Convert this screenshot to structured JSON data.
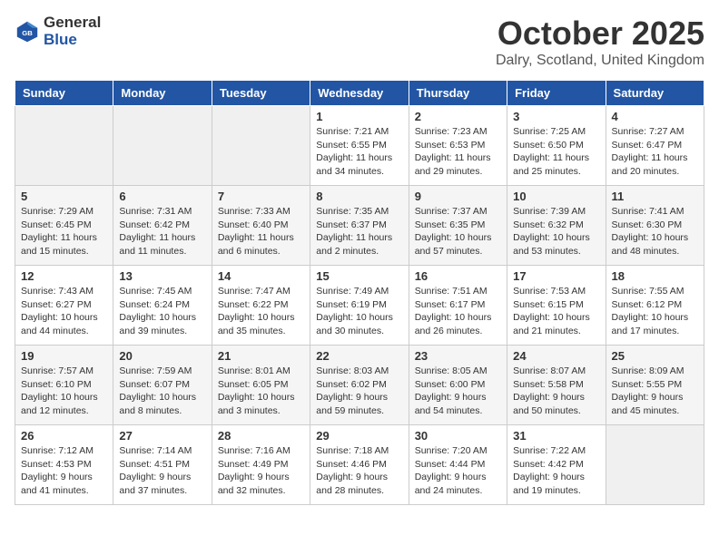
{
  "logo": {
    "general": "General",
    "blue": "Blue"
  },
  "title": "October 2025",
  "location": "Dalry, Scotland, United Kingdom",
  "days_of_week": [
    "Sunday",
    "Monday",
    "Tuesday",
    "Wednesday",
    "Thursday",
    "Friday",
    "Saturday"
  ],
  "weeks": [
    [
      {
        "num": "",
        "info": ""
      },
      {
        "num": "",
        "info": ""
      },
      {
        "num": "",
        "info": ""
      },
      {
        "num": "1",
        "info": "Sunrise: 7:21 AM\nSunset: 6:55 PM\nDaylight: 11 hours and 34 minutes."
      },
      {
        "num": "2",
        "info": "Sunrise: 7:23 AM\nSunset: 6:53 PM\nDaylight: 11 hours and 29 minutes."
      },
      {
        "num": "3",
        "info": "Sunrise: 7:25 AM\nSunset: 6:50 PM\nDaylight: 11 hours and 25 minutes."
      },
      {
        "num": "4",
        "info": "Sunrise: 7:27 AM\nSunset: 6:47 PM\nDaylight: 11 hours and 20 minutes."
      }
    ],
    [
      {
        "num": "5",
        "info": "Sunrise: 7:29 AM\nSunset: 6:45 PM\nDaylight: 11 hours and 15 minutes."
      },
      {
        "num": "6",
        "info": "Sunrise: 7:31 AM\nSunset: 6:42 PM\nDaylight: 11 hours and 11 minutes."
      },
      {
        "num": "7",
        "info": "Sunrise: 7:33 AM\nSunset: 6:40 PM\nDaylight: 11 hours and 6 minutes."
      },
      {
        "num": "8",
        "info": "Sunrise: 7:35 AM\nSunset: 6:37 PM\nDaylight: 11 hours and 2 minutes."
      },
      {
        "num": "9",
        "info": "Sunrise: 7:37 AM\nSunset: 6:35 PM\nDaylight: 10 hours and 57 minutes."
      },
      {
        "num": "10",
        "info": "Sunrise: 7:39 AM\nSunset: 6:32 PM\nDaylight: 10 hours and 53 minutes."
      },
      {
        "num": "11",
        "info": "Sunrise: 7:41 AM\nSunset: 6:30 PM\nDaylight: 10 hours and 48 minutes."
      }
    ],
    [
      {
        "num": "12",
        "info": "Sunrise: 7:43 AM\nSunset: 6:27 PM\nDaylight: 10 hours and 44 minutes."
      },
      {
        "num": "13",
        "info": "Sunrise: 7:45 AM\nSunset: 6:24 PM\nDaylight: 10 hours and 39 minutes."
      },
      {
        "num": "14",
        "info": "Sunrise: 7:47 AM\nSunset: 6:22 PM\nDaylight: 10 hours and 35 minutes."
      },
      {
        "num": "15",
        "info": "Sunrise: 7:49 AM\nSunset: 6:19 PM\nDaylight: 10 hours and 30 minutes."
      },
      {
        "num": "16",
        "info": "Sunrise: 7:51 AM\nSunset: 6:17 PM\nDaylight: 10 hours and 26 minutes."
      },
      {
        "num": "17",
        "info": "Sunrise: 7:53 AM\nSunset: 6:15 PM\nDaylight: 10 hours and 21 minutes."
      },
      {
        "num": "18",
        "info": "Sunrise: 7:55 AM\nSunset: 6:12 PM\nDaylight: 10 hours and 17 minutes."
      }
    ],
    [
      {
        "num": "19",
        "info": "Sunrise: 7:57 AM\nSunset: 6:10 PM\nDaylight: 10 hours and 12 minutes."
      },
      {
        "num": "20",
        "info": "Sunrise: 7:59 AM\nSunset: 6:07 PM\nDaylight: 10 hours and 8 minutes."
      },
      {
        "num": "21",
        "info": "Sunrise: 8:01 AM\nSunset: 6:05 PM\nDaylight: 10 hours and 3 minutes."
      },
      {
        "num": "22",
        "info": "Sunrise: 8:03 AM\nSunset: 6:02 PM\nDaylight: 9 hours and 59 minutes."
      },
      {
        "num": "23",
        "info": "Sunrise: 8:05 AM\nSunset: 6:00 PM\nDaylight: 9 hours and 54 minutes."
      },
      {
        "num": "24",
        "info": "Sunrise: 8:07 AM\nSunset: 5:58 PM\nDaylight: 9 hours and 50 minutes."
      },
      {
        "num": "25",
        "info": "Sunrise: 8:09 AM\nSunset: 5:55 PM\nDaylight: 9 hours and 45 minutes."
      }
    ],
    [
      {
        "num": "26",
        "info": "Sunrise: 7:12 AM\nSunset: 4:53 PM\nDaylight: 9 hours and 41 minutes."
      },
      {
        "num": "27",
        "info": "Sunrise: 7:14 AM\nSunset: 4:51 PM\nDaylight: 9 hours and 37 minutes."
      },
      {
        "num": "28",
        "info": "Sunrise: 7:16 AM\nSunset: 4:49 PM\nDaylight: 9 hours and 32 minutes."
      },
      {
        "num": "29",
        "info": "Sunrise: 7:18 AM\nSunset: 4:46 PM\nDaylight: 9 hours and 28 minutes."
      },
      {
        "num": "30",
        "info": "Sunrise: 7:20 AM\nSunset: 4:44 PM\nDaylight: 9 hours and 24 minutes."
      },
      {
        "num": "31",
        "info": "Sunrise: 7:22 AM\nSunset: 4:42 PM\nDaylight: 9 hours and 19 minutes."
      },
      {
        "num": "",
        "info": ""
      }
    ]
  ]
}
